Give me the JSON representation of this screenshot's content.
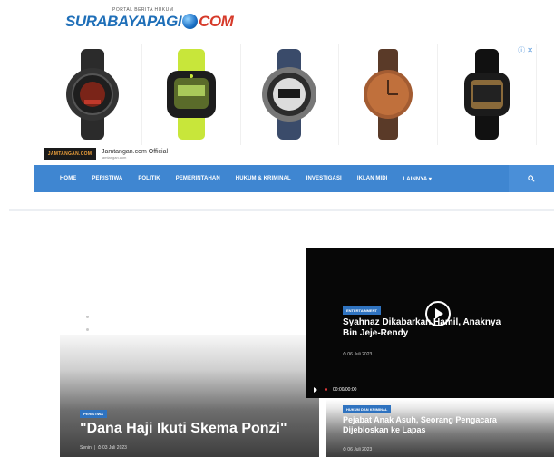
{
  "logo": {
    "tagline": "PORTAL BERITA HUKUM",
    "name": "SURABAYAPAGI",
    "suffix": "COM"
  },
  "ad": {
    "brand_logo": "JAMTANGAN.COM",
    "brand_name": "Jamtangan.com Official",
    "brand_url": "jamtangan.com",
    "products": [
      {
        "icon": "watch-black-red",
        "face": "#2a2a2a",
        "accent": "#c0392b"
      },
      {
        "icon": "watch-gshock-yellow",
        "face": "#1d1d1d",
        "accent": "#c8e63a"
      },
      {
        "icon": "watch-digital-silver",
        "face": "#dcdcdc",
        "accent": "#3a4b6a"
      },
      {
        "icon": "watch-analog-copper",
        "face": "#c0703c",
        "accent": "#5a3a28"
      },
      {
        "icon": "watch-digital-black",
        "face": "#111111",
        "accent": "#8a6a3a"
      }
    ]
  },
  "nav": {
    "items": [
      "HOME",
      "PERISTIWA",
      "POLITIK",
      "PEMERINTAHAN",
      "HUKUM & KRIMINAL",
      "INVESTIGASI",
      "IKLAN MIDI",
      "LAINNYA ▾"
    ],
    "search_icon": "search-icon"
  },
  "featured": {
    "badge": "PERISTIWA",
    "title": "\"Dana Haji Ikuti Skema Ponzi\"",
    "author": "Senin",
    "date": "03 Juli 2023"
  },
  "video": {
    "badge": "ENTERTAINMENT",
    "title": "Syahnaz Dikabarkan Hamil, Anaknya Bin Jeje-Rendy",
    "date": "06 Juli 2023",
    "time": "00:00/00:00"
  },
  "card2": {
    "badge": "HUKUM DAN KRIMINAL",
    "title": "Pejabat Anak Asuh, Seorang Pengacara Dijebloskan ke Lapas",
    "date": "06 Juli 2023"
  },
  "colors": {
    "nav": "#3f86d1",
    "badge": "#2f73c0",
    "logo_blue": "#1f6fb8",
    "logo_red": "#d63a2a"
  }
}
